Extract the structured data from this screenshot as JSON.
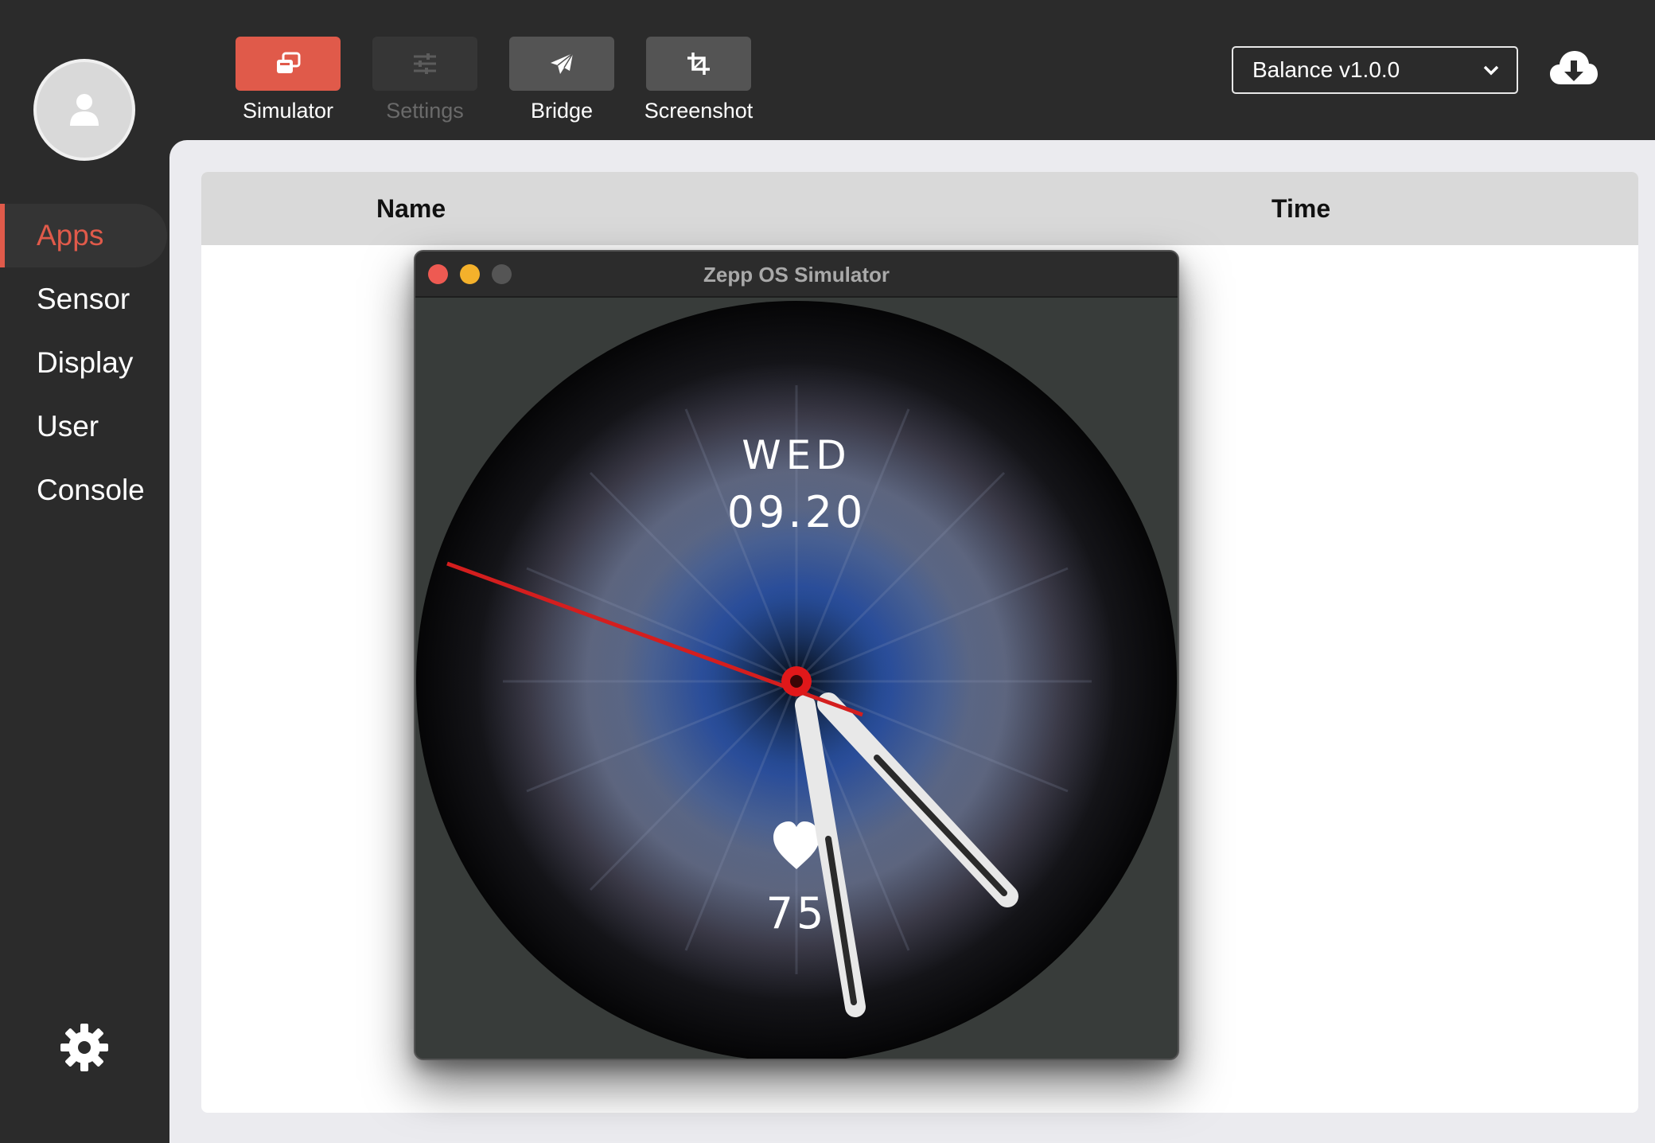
{
  "toolbar": {
    "simulator_label": "Simulator",
    "settings_label": "Settings",
    "bridge_label": "Bridge",
    "screenshot_label": "Screenshot"
  },
  "version_select": {
    "selected": "Balance v1.0.0"
  },
  "sidebar": {
    "items": [
      {
        "label": "Apps",
        "active": true
      },
      {
        "label": "Sensor",
        "active": false
      },
      {
        "label": "Display",
        "active": false
      },
      {
        "label": "User",
        "active": false
      },
      {
        "label": "Console",
        "active": false
      }
    ]
  },
  "table": {
    "columns": [
      "Name",
      "Time"
    ]
  },
  "simulator": {
    "title": "Zepp OS Simulator",
    "watch": {
      "weekday": "WED",
      "date": "09.20",
      "heart_rate": "75"
    }
  },
  "colors": {
    "accent": "#e05a4a",
    "sidebar_bg": "#2b2b2b",
    "content_bg": "#ebebef",
    "second_hand": "#d41e1e"
  },
  "icons": [
    "user-icon",
    "simulator-icon",
    "settings-sliders-icon",
    "paper-plane-icon",
    "crop-icon",
    "chevron-down-icon",
    "cloud-download-icon",
    "gear-icon",
    "heart-icon"
  ]
}
